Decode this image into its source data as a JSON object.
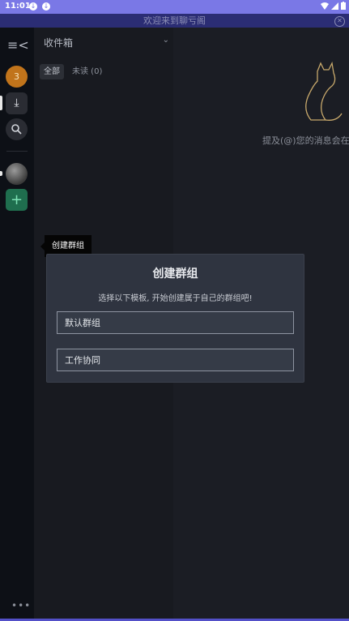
{
  "status_bar": {
    "time": "11:01",
    "notification_badge_1": "↓",
    "notification_badge_2": "↓",
    "wifi_icon": "wifi-icon",
    "signal_icon": "signal-icon",
    "battery_icon": "battery-icon",
    "accent_color": "#7a78e6"
  },
  "banner": {
    "text": "欢迎来到聊亏阁",
    "close_glyph": "✕"
  },
  "rail": {
    "menu_glyph": "≡<",
    "unread_badge": "3",
    "inbox_glyph": "⤓",
    "search_glyph": "🔍",
    "add_glyph": "+",
    "more_glyph": "•••"
  },
  "inbox_panel": {
    "title": "收件箱",
    "chevron_glyph": "⌄",
    "tab_all": "全部",
    "tab_unread": "未读 (0)"
  },
  "main": {
    "empty_text": "提及(@)您的消息会在"
  },
  "tooltip": {
    "text": "创建群组"
  },
  "modal": {
    "title": "创建群组",
    "description": "选择以下模板, 开始创建属于自己的群组吧!",
    "option_default": "默认群组",
    "option_work": "工作协同"
  }
}
